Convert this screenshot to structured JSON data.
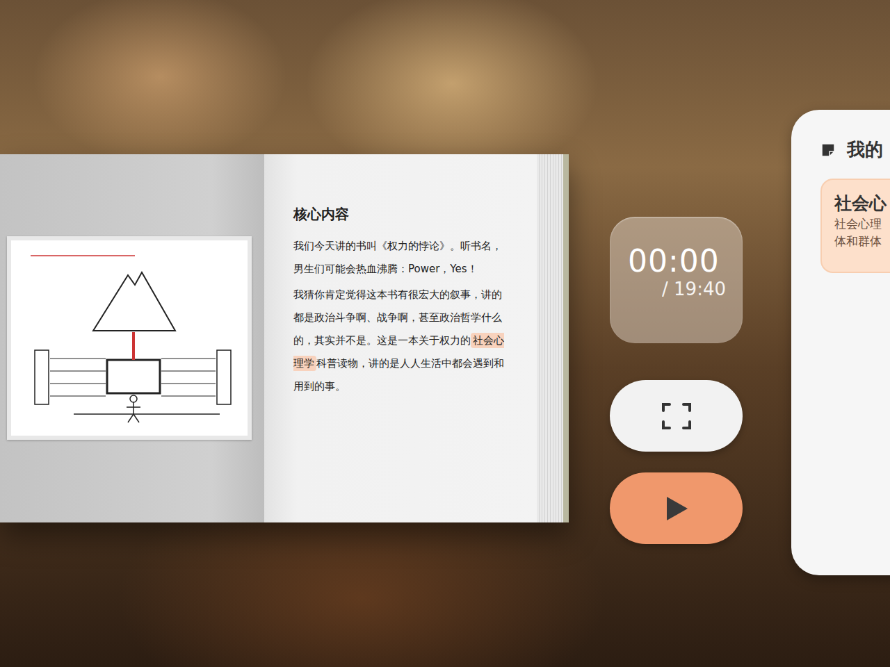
{
  "book": {
    "heading": "核心内容",
    "paragraphs": [
      {
        "segments": [
          {
            "text": "我们今天讲的书叫《权力的悖论》。听书名，男生们可能会热血沸腾：Power，Yes！",
            "highlighted": false
          }
        ]
      },
      {
        "segments": [
          {
            "text": "我猜你肯定觉得这本书有很宏大的叙事，讲的都是政治斗争啊、战争啊，甚至政治哲学什么的，其实并不是。这是一本关于权力的",
            "highlighted": false
          },
          {
            "text": "社会心理学",
            "highlighted": true
          },
          {
            "text": "科普读物，讲的是人人生活中都会遇到和用到的事。",
            "highlighted": false
          }
        ]
      }
    ]
  },
  "player": {
    "elapsed": "00:00",
    "duration": "/ 19:40",
    "playing": false
  },
  "notes_panel": {
    "title": "我的",
    "cards": [
      {
        "title": "社会心",
        "lines": [
          "社会心理",
          "体和群体"
        ]
      }
    ]
  }
}
